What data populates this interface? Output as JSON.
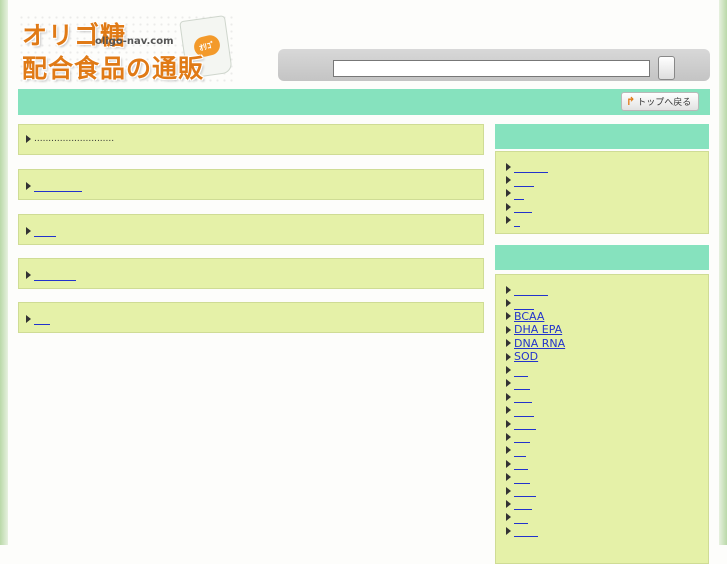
{
  "logo": {
    "line1": "オリゴ糖",
    "line2": "配合食品の通販",
    "domain": "oligo-nav.com",
    "badge": "ｵﾘｺﾞ"
  },
  "search": {
    "value": "",
    "button_label": ""
  },
  "navbar": {
    "top_button_label": "トップへ戻る"
  },
  "main_items": [
    {
      "text": "............................",
      "underline": false
    },
    {
      "text": "",
      "underline": true
    },
    {
      "text": "",
      "underline": true
    },
    {
      "text": "",
      "underline": true
    },
    {
      "text": "",
      "underline": true
    }
  ],
  "side_list_1": [
    "",
    "",
    "",
    "",
    ""
  ],
  "side_list_2": [
    "",
    "",
    "BCAA",
    "DHA EPA",
    "DNA RNA",
    "SOD",
    "",
    "",
    "",
    "",
    "",
    "",
    "",
    "",
    "",
    "",
    "",
    "",
    ""
  ],
  "colors": {
    "accent_green": "#86e2be",
    "box_yellow": "#e5f1a8",
    "link_blue": "#2233cc",
    "logo_orange": "#e07a16"
  },
  "icons": {
    "list_arrow": "triangle-right-icon",
    "top_arrow": "return-arrow-icon"
  }
}
